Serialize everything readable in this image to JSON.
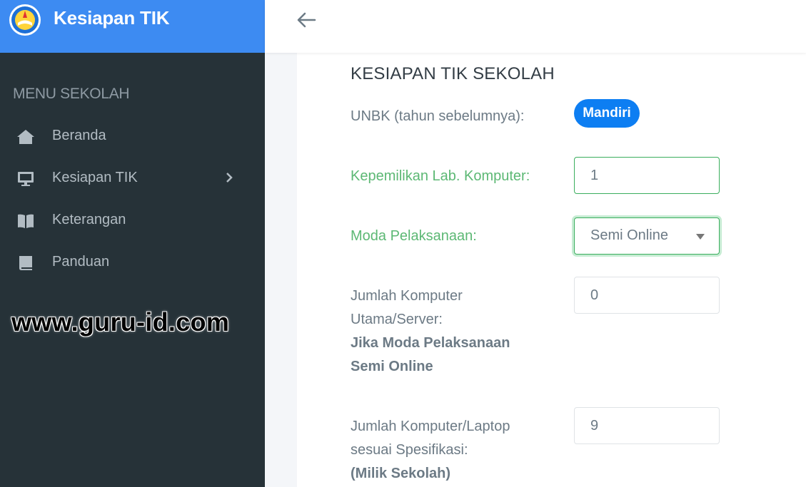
{
  "sidebar": {
    "brand": {
      "title": "Kesiapan TIK",
      "logo_icon": "tut-wuri-handayani-logo"
    },
    "menu_header": "MENU SEKOLAH",
    "items": [
      {
        "label": "Beranda",
        "icon": "home-icon"
      },
      {
        "label": "Kesiapan TIK",
        "icon": "monitor-icon",
        "has_submenu": true
      },
      {
        "label": "Keterangan",
        "icon": "book-open-icon"
      },
      {
        "label": "Panduan",
        "icon": "book-icon"
      }
    ],
    "watermark": "www.guru-id.com"
  },
  "topbar": {
    "back_icon": "arrow-left-icon"
  },
  "form": {
    "title": "KESIAPAN TIK SEKOLAH",
    "unbk": {
      "label": "UNBK (tahun sebelumnya):",
      "value": "Mandiri"
    },
    "lab": {
      "label": "Kepemilikan Lab. Komputer:",
      "value": "1"
    },
    "moda": {
      "label": "Moda Pelaksanaan:",
      "value": "Semi Online"
    },
    "server": {
      "label_line1": "Jumlah Komputer",
      "label_line2": "Utama/Server:",
      "note_line1": "Jika Moda Pelaksanaan",
      "note_line2": "Semi Online",
      "value": "0"
    },
    "laptop": {
      "label_line1": "Jumlah Komputer/Laptop",
      "label_line2": "sesuai Spesifikasi:",
      "note": "(Milik Sekolah)",
      "value": "9"
    }
  },
  "colors": {
    "brand_blue": "#3d8bf2",
    "sidebar_bg": "#263238",
    "badge_blue": "#0d7ef2",
    "valid_green": "#5cb874"
  }
}
